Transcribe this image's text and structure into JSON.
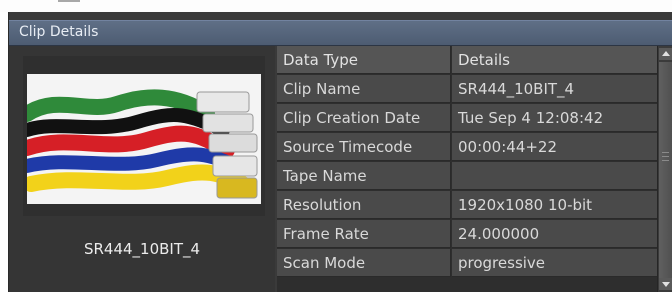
{
  "panel": {
    "title": "Clip Details"
  },
  "thumbnail": {
    "clip_name": "SR444_10BIT_4"
  },
  "table": {
    "headers": [
      "Data Type",
      "Details"
    ],
    "rows": [
      [
        "Clip Name",
        "SR444_10BIT_4"
      ],
      [
        "Clip Creation Date",
        "Tue Sep  4 12:08:42"
      ],
      [
        "Source Timecode",
        "00:00:44+22"
      ],
      [
        "Tape Name",
        ""
      ],
      [
        "Resolution",
        "1920x1080 10-bit"
      ],
      [
        "Frame Rate",
        "24.000000"
      ],
      [
        "Scan Mode",
        "progressive"
      ]
    ]
  },
  "colors": {
    "title_bar": "#55657c",
    "panel_bg": "#3a3a3a",
    "cell_bg": "#4a4a4a",
    "text": "#d9d9d9"
  },
  "icons": [
    "scroll-up-icon",
    "scroll-down-icon"
  ]
}
